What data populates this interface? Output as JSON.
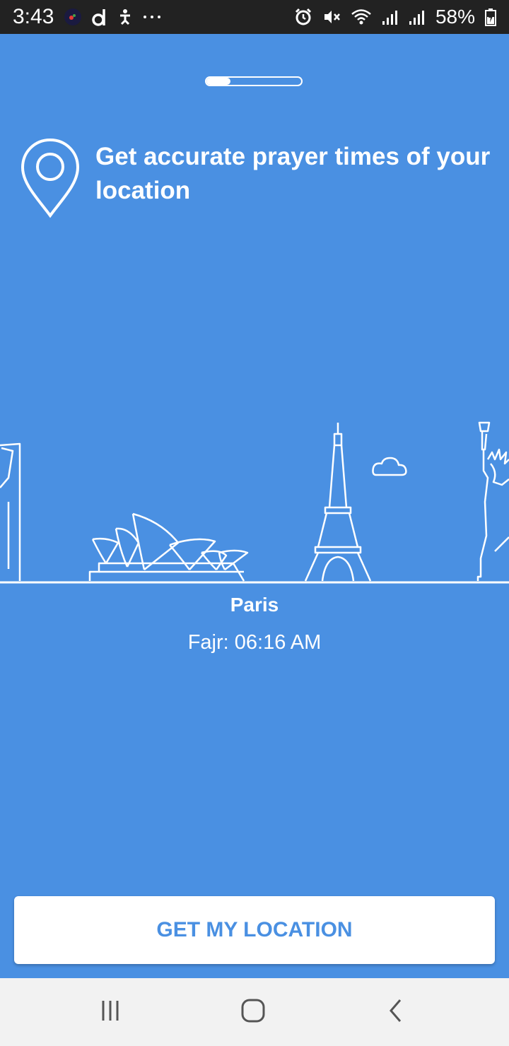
{
  "status_bar": {
    "time": "3:43",
    "battery": "58%",
    "left_icons": [
      "app-notification-icon",
      "d-app-icon",
      "accessibility-icon",
      "more-notifications-icon"
    ],
    "right_icons": [
      "alarm-icon",
      "mute-icon",
      "wifi-icon",
      "signal-icon",
      "signal-icon-2",
      "battery-icon"
    ]
  },
  "onboarding": {
    "progress": 0.25,
    "headline": "Get accurate prayer times of your location",
    "city": "Paris",
    "prayer_time": "Fajr: 06:16 AM"
  },
  "cta": {
    "label": "GET MY LOCATION"
  },
  "nav": {
    "icons": [
      "recent-apps-icon",
      "home-icon",
      "back-icon"
    ]
  },
  "colors": {
    "background": "#4a90e2",
    "accent": "#4a90e2",
    "status_bar": "#222222",
    "nav_bar": "#f2f2f2"
  }
}
